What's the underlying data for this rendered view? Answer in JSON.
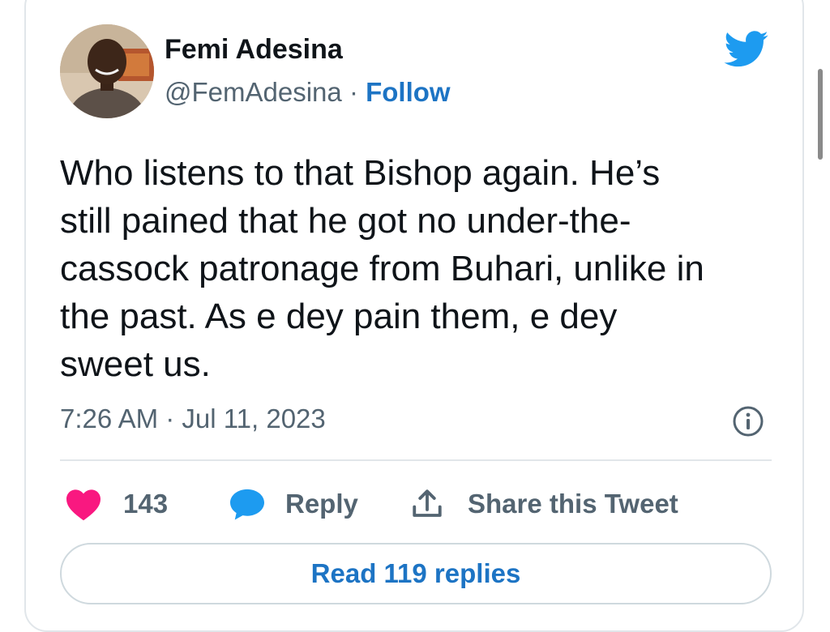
{
  "author": {
    "name": "Femi Adesina",
    "handle": "@FemAdesina",
    "separator": "·",
    "follow_label": "Follow"
  },
  "tweet": {
    "lines": [
      "Who listens to that Bishop again. He’s",
      "still pained that he got no under-the-",
      "cassock patronage from Buhari, unlike in",
      "the past. As e dey pain them, e dey",
      "sweet us."
    ],
    "timestamp": "7:26 AM · Jul 11, 2023"
  },
  "actions": {
    "like_count": "143",
    "reply_label": "Reply",
    "share_label": "Share this Tweet"
  },
  "read_replies_label": "Read 119 replies",
  "colors": {
    "brand_blue": "#1d9bf0",
    "link_blue": "#1d74c4",
    "heart_pink": "#f91880",
    "muted_text": "#536471"
  },
  "icons": {
    "logo": "twitter-bird-icon",
    "info": "info-icon",
    "like": "heart-icon",
    "reply": "speech-bubble-icon",
    "share": "share-upload-icon"
  }
}
